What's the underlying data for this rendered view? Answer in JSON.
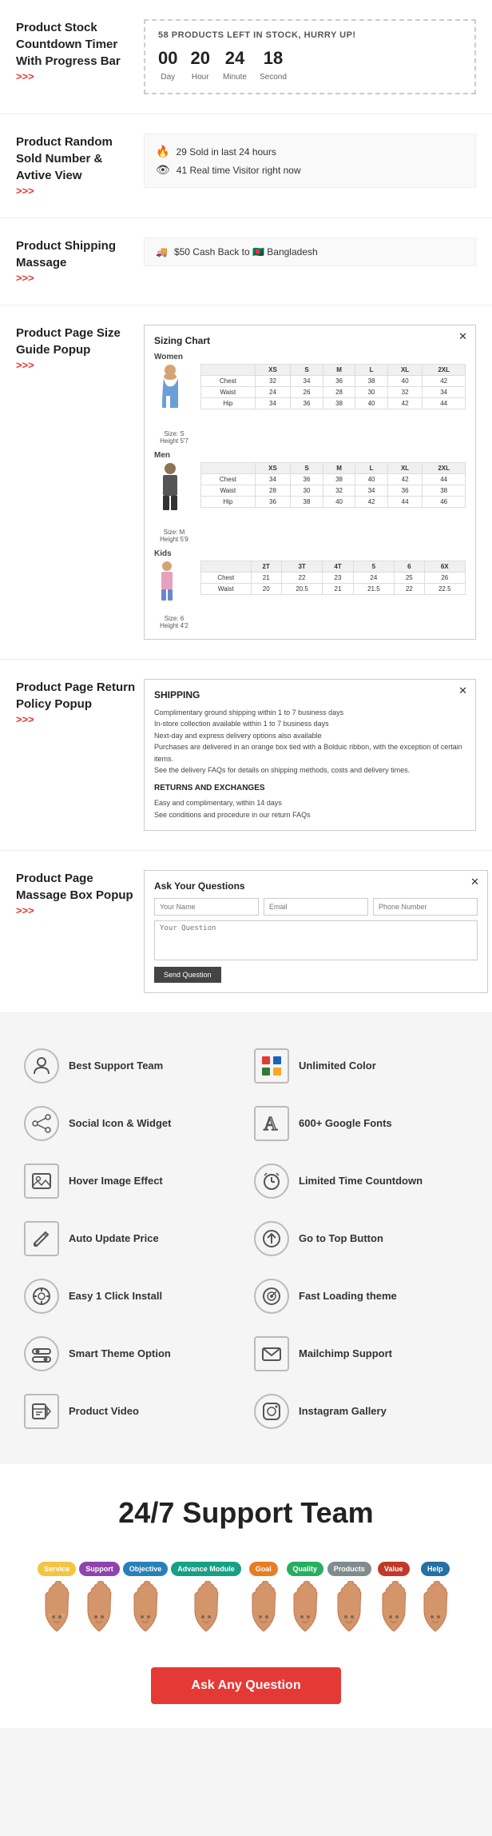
{
  "sections": [
    {
      "id": "countdown",
      "title": "Product Stock Countdown Timer With Progress Bar",
      "arrows": ">>>",
      "countdown": {
        "header": "58 PRODUCTS LEFT IN STOCK, HURRY UP!",
        "units": [
          {
            "number": "00",
            "label": "Day"
          },
          {
            "number": "20",
            "label": "Hour"
          },
          {
            "number": "24",
            "label": "Minute"
          },
          {
            "number": "18",
            "label": "Second"
          }
        ]
      }
    },
    {
      "id": "sold",
      "title": "Product Random Sold Number & Avtive View",
      "arrows": ">>>",
      "sold": {
        "row1": "29 Sold in last 24 hours",
        "row2": "41 Real time Visitor right now"
      }
    },
    {
      "id": "shipping",
      "title": "Product Shipping Massage",
      "arrows": ">>>",
      "shipping_text": "$50 Cash Back to 🇧🇩 Bangladesh"
    },
    {
      "id": "sizeguide",
      "title": "Product Page Size Guide Popup",
      "arrows": ">>>"
    },
    {
      "id": "returnpolicy",
      "title": "Product Page Return Policy Popup",
      "arrows": ">>>"
    },
    {
      "id": "messagebox",
      "title": "Product Page Massage Box Popup",
      "arrows": ">>>"
    }
  ],
  "return_popup": {
    "title": "SHIPPING",
    "line1": "Complimentary ground shipping within 1 to 7 business days",
    "line2": "In-store collection available within 1 to 7 business days",
    "line3": "Next-day and express delivery options also available",
    "line4": "Purchases are delivered in an orange box tied with a Bolduic ribbon, with the exception of certain items.",
    "line5": "See the delivery FAQs for details on shipping methods, costs and delivery times.",
    "section2": "RETURNS AND EXCHANGES",
    "line6": "Easy and complimentary, within 14 days",
    "line7": "See conditions and procedure in our return FAQs"
  },
  "message_popup": {
    "title": "Ask Your Questions",
    "field1": "Your Name",
    "field2": "Email",
    "field3": "Phone Number",
    "field4": "Your Question",
    "button": "Send Question"
  },
  "features": [
    {
      "label": "Best Support Team",
      "icon": "👤",
      "shape": "circle"
    },
    {
      "label": "Unlimited Color",
      "icon": "🎨",
      "shape": "square"
    },
    {
      "label": "Social Icon & Widget",
      "icon": "⚙",
      "shape": "circle"
    },
    {
      "label": "600+ Google Fonts",
      "icon": "A",
      "shape": "square"
    },
    {
      "label": "Hover Image Effect",
      "icon": "🖼",
      "shape": "square"
    },
    {
      "label": "Limited Time Countdown",
      "icon": "⏰",
      "shape": "circle"
    },
    {
      "label": "Auto Update Price",
      "icon": "✏",
      "shape": "square"
    },
    {
      "label": "Go to Top Button",
      "icon": "↑",
      "shape": "circle"
    },
    {
      "label": "Easy 1 Click Install",
      "icon": "⚙",
      "shape": "circle"
    },
    {
      "label": "Fast Loading theme",
      "icon": "⚙",
      "shape": "circle"
    },
    {
      "label": "Smart Theme Option",
      "icon": "⚙",
      "shape": "circle"
    },
    {
      "label": "Mailchimp Support",
      "icon": "✉",
      "shape": "square"
    },
    {
      "label": "Product Video",
      "icon": "▶",
      "shape": "square"
    },
    {
      "label": "Instagram Gallery",
      "icon": "📷",
      "shape": "circle"
    }
  ],
  "support": {
    "title": "24/7 Support Team",
    "ask_button": "Ask Any Question",
    "bubbles": [
      {
        "text": "Service",
        "color": "#f4c542"
      },
      {
        "text": "Support",
        "color": "#8e44ad"
      },
      {
        "text": "Objective",
        "color": "#2980b9"
      },
      {
        "text": "Advance Module",
        "color": "#16a085"
      },
      {
        "text": "Goal",
        "color": "#e67e22"
      },
      {
        "text": "Quality",
        "color": "#27ae60"
      },
      {
        "text": "Products",
        "color": "#7f8c8d"
      },
      {
        "text": "Value",
        "color": "#c0392b"
      },
      {
        "text": "Help",
        "color": "#2471a3"
      }
    ]
  }
}
